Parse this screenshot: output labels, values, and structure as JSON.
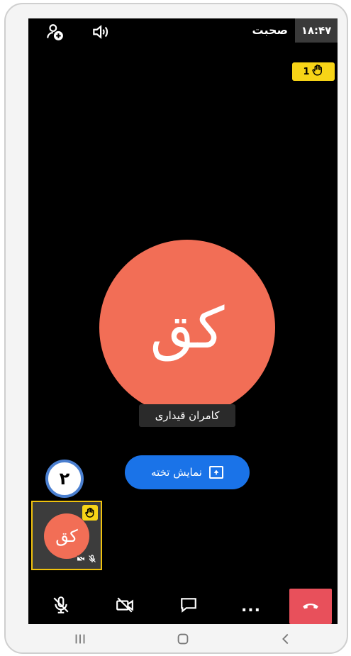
{
  "status_bar": {
    "time": "۱۸:۴۷",
    "title": "صحبت"
  },
  "raised_hands": {
    "count": "1"
  },
  "participant": {
    "initials": "کق",
    "name": "کامران قیداری"
  },
  "board_button": {
    "label": "نمایش تخته"
  },
  "step_marker": {
    "number": "۲"
  },
  "thumbnail": {
    "initials": "کق"
  },
  "toolbar": {
    "more_label": "..."
  },
  "colors": {
    "screen_bg": "#000000",
    "avatar": "#f26e56",
    "accent_blue": "#1a73e8",
    "hand_yellow": "#f7d417",
    "end_call_red": "#e8505b"
  },
  "icons": {
    "add_person": "add-person-icon",
    "speaker": "speaker-icon",
    "hand": "raised-hand-icon",
    "mic_off": "mic-off-icon",
    "camera_off": "camera-off-icon",
    "chat": "chat-icon",
    "end_call": "end-call-icon",
    "present": "present-upload-icon"
  }
}
